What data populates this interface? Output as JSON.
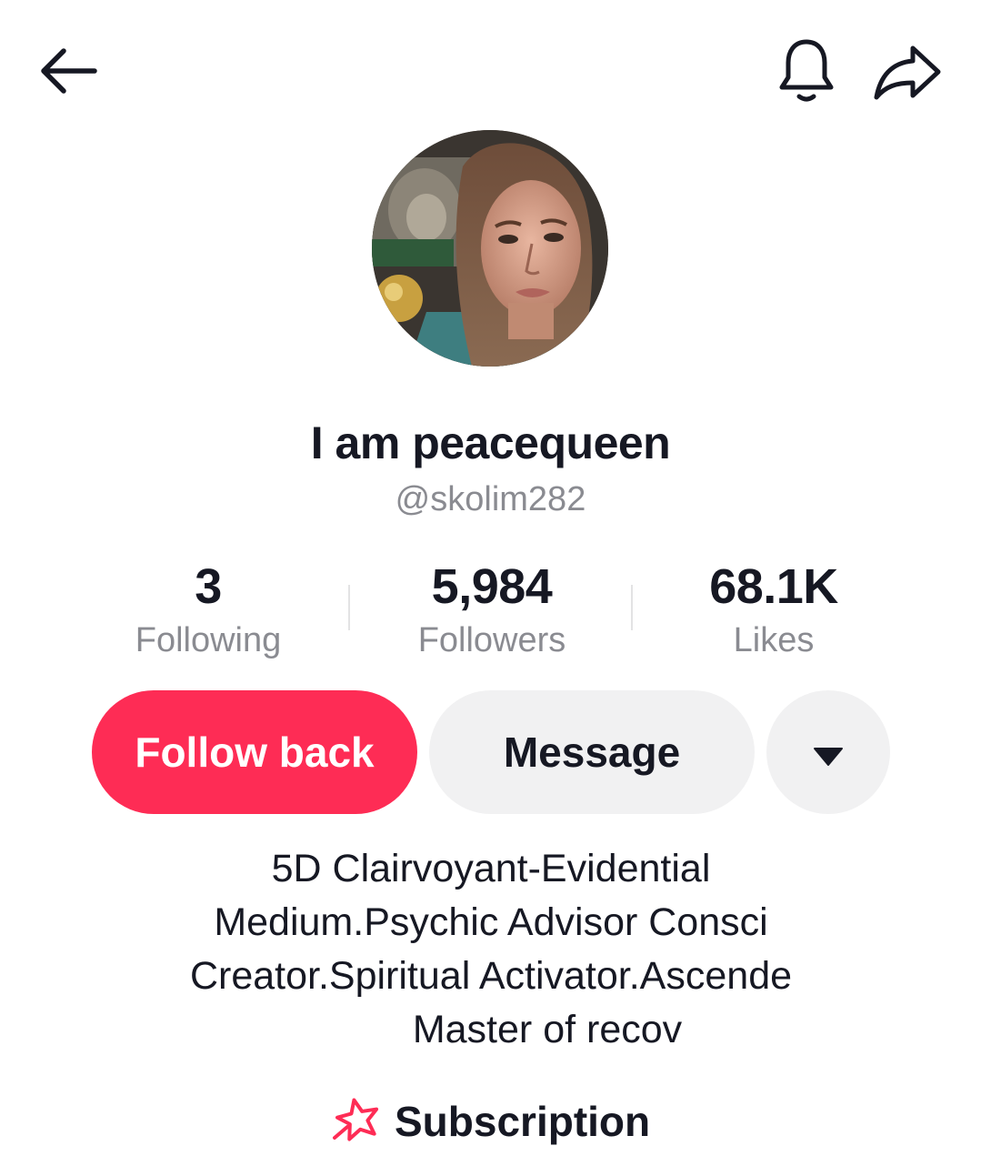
{
  "header": {
    "back_icon": "arrow-left-icon",
    "notification_icon": "bell-icon",
    "share_icon": "share-arrow-icon"
  },
  "profile": {
    "avatar_alt": "profile photo",
    "display_name": "I am peacequeen",
    "handle": "@skolim282"
  },
  "stats": {
    "following": {
      "value": "3",
      "label": "Following"
    },
    "followers": {
      "value": "5,984",
      "label": "Followers"
    },
    "likes": {
      "value": "68.1K",
      "label": "Likes"
    }
  },
  "actions": {
    "follow_back_label": "Follow back",
    "message_label": "Message",
    "more_icon": "caret-down-icon"
  },
  "bio": {
    "lines": [
      "5D Clairvoyant-Evidential",
      "Medium.Psychic Advisor Consci",
      "Creator.Spiritual Activator.Ascende",
      "Master of recov"
    ]
  },
  "subscription": {
    "label": "Subscription",
    "icon": "star-icon"
  },
  "colors": {
    "accent": "#fe2c55",
    "text_primary": "#161823",
    "text_secondary": "#8a8b91",
    "button_secondary_bg": "#f1f1f2"
  }
}
